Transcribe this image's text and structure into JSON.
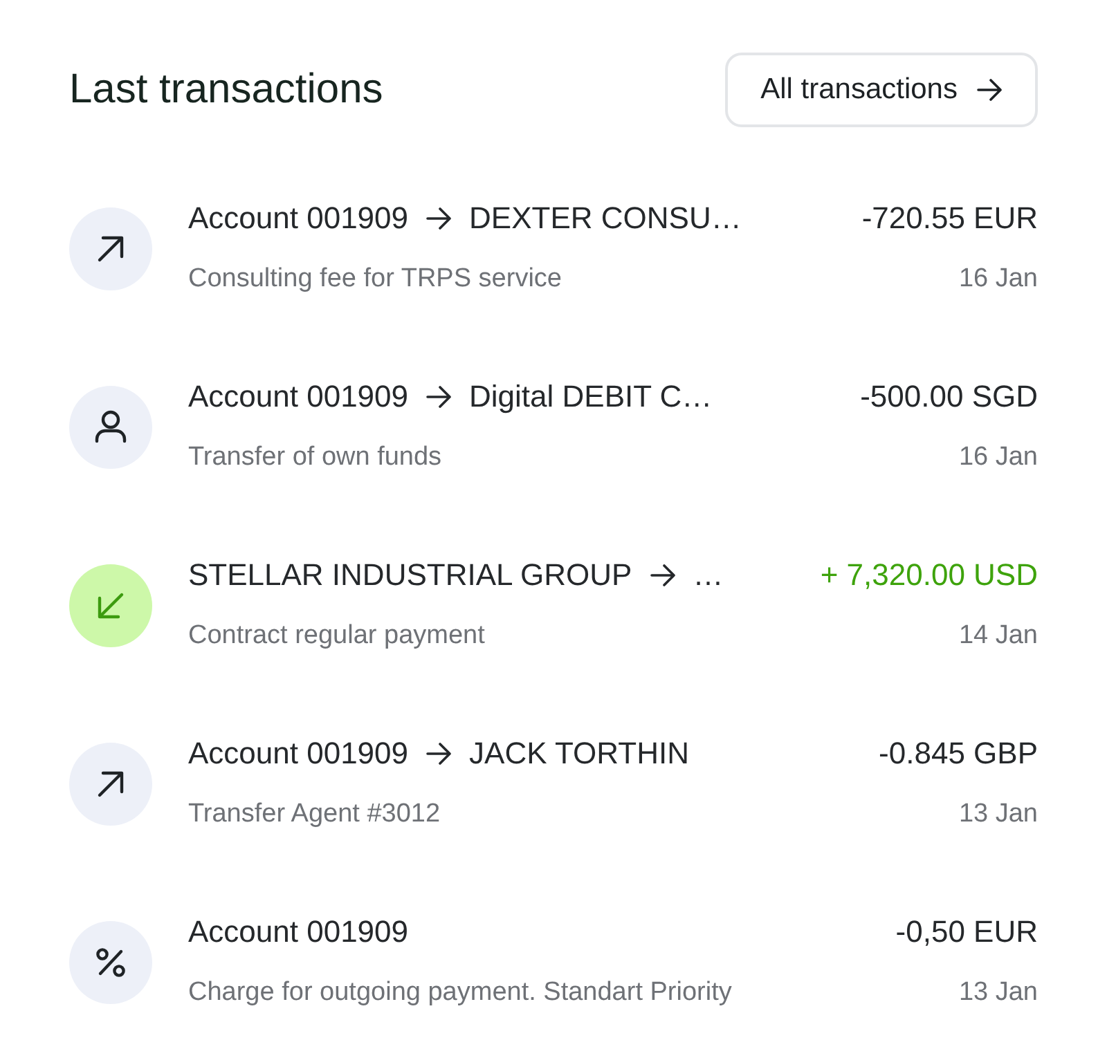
{
  "header": {
    "title": "Last transactions",
    "button": {
      "label": "All transactions"
    }
  },
  "transactions": [
    {
      "kind": "outgoing",
      "from": "Account 001909",
      "to": "DEXTER CONSU…",
      "amount": "-720.55 EUR",
      "incoming": false,
      "description": "Consulting fee for TRPS service",
      "date": "16 Jan"
    },
    {
      "kind": "person",
      "from": "Account 001909",
      "to": "Digital DEBIT C…",
      "amount": "-500.00 SGD",
      "incoming": false,
      "description": "Transfer of own funds",
      "date": "16 Jan"
    },
    {
      "kind": "incoming",
      "from": "STELLAR INDUSTRIAL GROUP",
      "to": "…",
      "amount": "+ 7,320.00 USD",
      "incoming": true,
      "description": "Contract regular payment",
      "date": "14 Jan"
    },
    {
      "kind": "outgoing",
      "from": "Account 001909",
      "to": "JACK TORTHIN",
      "amount": "-0.845 GBP",
      "incoming": false,
      "description": "Transfer Agent #3012",
      "date": "13 Jan"
    },
    {
      "kind": "fee",
      "from": "Account 001909",
      "amount": "-0,50 EUR",
      "incoming": false,
      "description": "Charge for outgoing payment. Standart Priority",
      "date": "13 Jan"
    }
  ]
}
